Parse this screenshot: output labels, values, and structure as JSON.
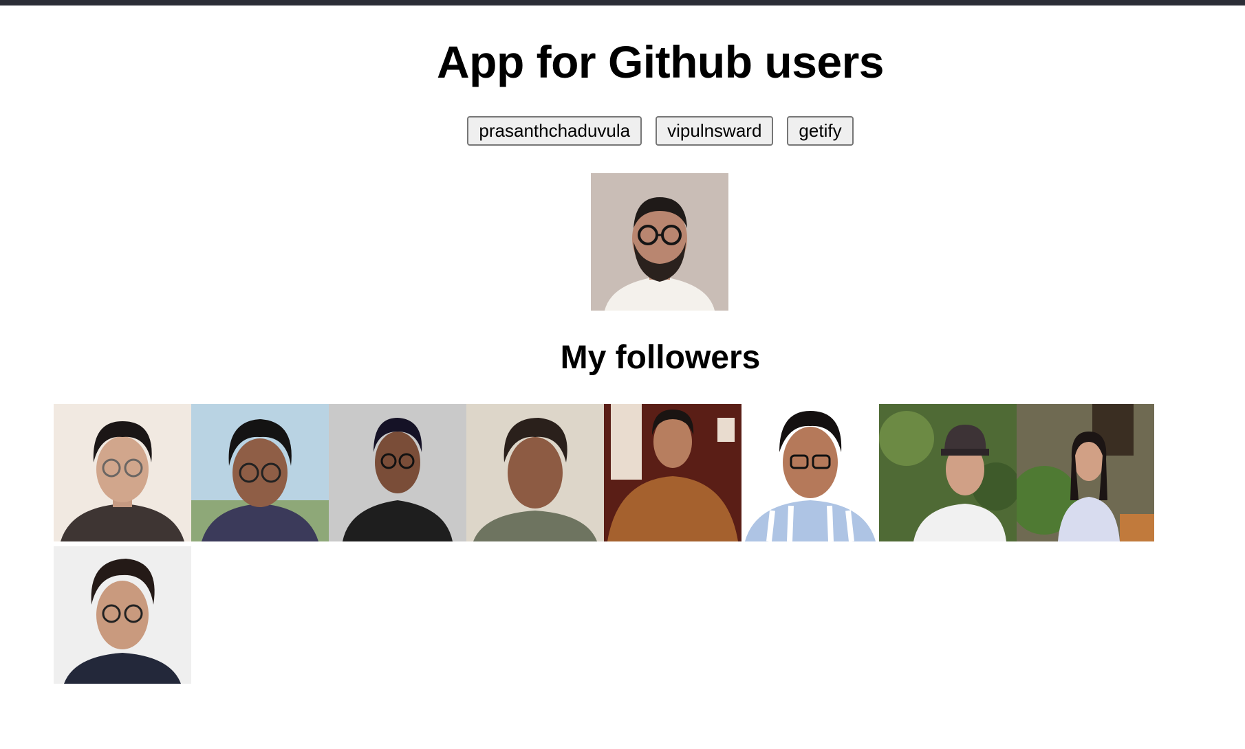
{
  "header": {
    "title": "App for Github users"
  },
  "users": [
    {
      "label": "prasanthchaduvula"
    },
    {
      "label": "vipulnsward"
    },
    {
      "label": "getify"
    }
  ],
  "profile": {
    "avatar_icon": "user-avatar-photo"
  },
  "followers_section": {
    "title": "My followers",
    "count": 9
  },
  "colors": {
    "topbar": "#2b2d36",
    "button_bg": "#efefef",
    "button_border": "#767676"
  }
}
